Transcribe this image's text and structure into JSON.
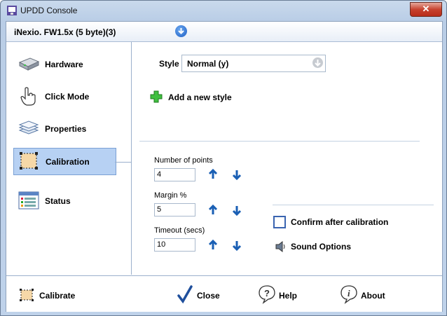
{
  "window": {
    "title": "UPDD Console",
    "close_glyph": "✕"
  },
  "device": {
    "name": "iNexio. FW1.5x (5 byte)(3)"
  },
  "nav": {
    "items": [
      {
        "label": "Hardware",
        "icon": "hardware-icon",
        "active": false
      },
      {
        "label": "Click Mode",
        "icon": "hand-pointer-icon",
        "active": false
      },
      {
        "label": "Properties",
        "icon": "layers-icon",
        "active": false
      },
      {
        "label": "Calibration",
        "icon": "calibration-icon",
        "active": true
      },
      {
        "label": "Status",
        "icon": "status-list-icon",
        "active": false
      }
    ]
  },
  "style": {
    "label": "Style",
    "value": "Normal (y)",
    "add_label": "Add a new style"
  },
  "fields": {
    "points": {
      "label": "Number of points",
      "value": "4"
    },
    "margin": {
      "label": "Margin %",
      "value": "5"
    },
    "timeout": {
      "label": "Timeout (secs)",
      "value": "10"
    }
  },
  "options": {
    "confirm_label": "Confirm after calibration",
    "confirm_checked": false,
    "sound_label": "Sound Options"
  },
  "bottom": {
    "calibrate": "Calibrate",
    "close": "Close",
    "help": "Help",
    "about": "About"
  },
  "colors": {
    "accent": "#1f5fc4",
    "active_nav": "#b7d1f3",
    "arrow_blue": "#1a5fb4"
  }
}
